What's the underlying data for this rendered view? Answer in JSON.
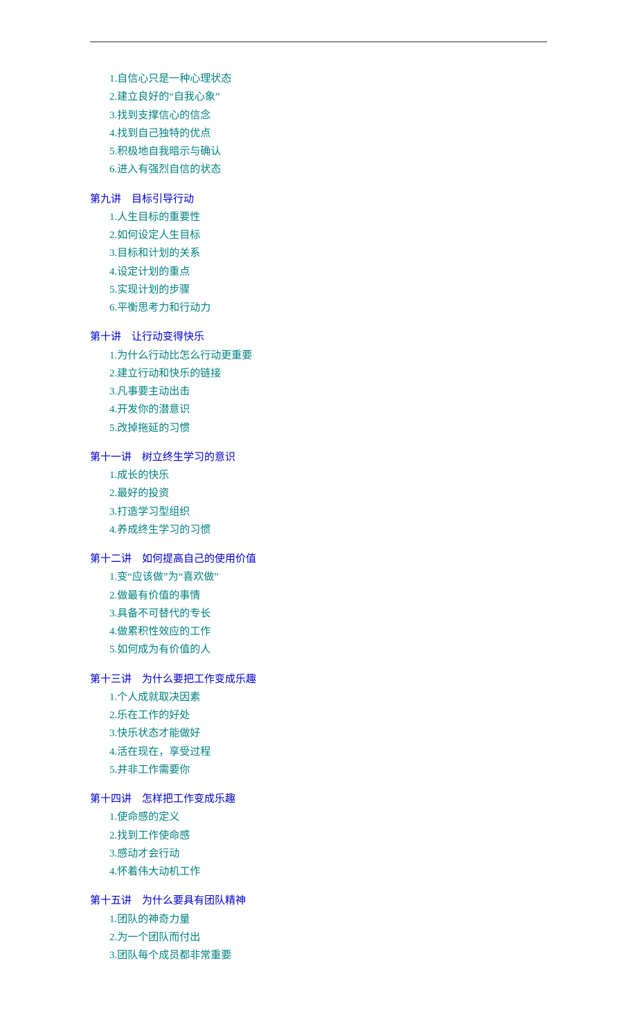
{
  "top_items": [
    "1.自信心只是一种心理状态",
    "2.建立良好的“自我心象”",
    "3.找到支撑信心的信念",
    "4.找到自己独特的优点",
    "5.积极地自我暗示与确认",
    "6.进入有强烈自信的状态"
  ],
  "sections": [
    {
      "heading": "第九讲　目标引导行动",
      "items": [
        "1.人生目标的重要性",
        "2.如何设定人生目标",
        "3.目标和计划的关系",
        "4.设定计划的重点",
        "5.实现计划的步骤",
        "6.平衡思考力和行动力"
      ]
    },
    {
      "heading": "第十讲　让行动变得快乐",
      "items": [
        "1.为什么行动比怎么行动更重要",
        "2.建立行动和快乐的链接",
        "3.凡事要主动出击",
        "4.开发你的潜意识",
        "5.改掉拖延的习惯"
      ]
    },
    {
      "heading": "第十一讲　树立终生学习的意识",
      "items": [
        "1.成长的快乐",
        "2.最好的投资",
        "3.打造学习型组织",
        "4.养成终生学习的习惯"
      ]
    },
    {
      "heading": "第十二讲　如何提高自己的使用价值",
      "items": [
        "1.变“应该做”为“喜欢做”",
        "2.做最有价值的事情",
        "3.具备不可替代的专长",
        "4.做累积性效应的工作",
        "5.如何成为有价值的人"
      ]
    },
    {
      "heading": "第十三讲　为什么要把工作变成乐趣",
      "items": [
        "1.个人成就取决因素",
        "2.乐在工作的好处",
        "3.快乐状态才能做好",
        "4.活在现在，享受过程",
        "5.并非工作需要你"
      ]
    },
    {
      "heading": "第十四讲　怎样把工作变成乐趣",
      "items": [
        "1.使命感的定义",
        "2.找到工作使命感",
        "3.感动才会行动",
        "4.怀着伟大动机工作"
      ]
    },
    {
      "heading": "第十五讲　为什么要具有团队精神",
      "items": [
        "1.团队的神奇力量",
        "2.为一个团队而付出",
        "3.团队每个成员都非常重要"
      ]
    }
  ]
}
